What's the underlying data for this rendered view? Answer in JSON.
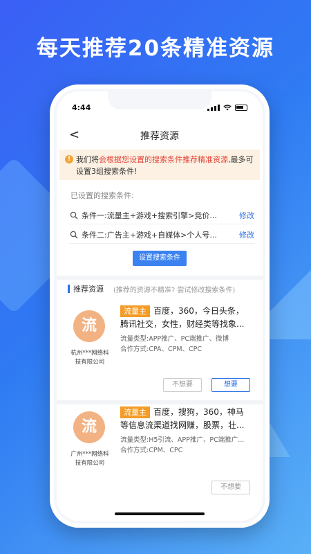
{
  "headline": "每天推荐20条精准资源",
  "status": {
    "time": "4:44"
  },
  "nav": {
    "back": "<",
    "title": "推荐资源"
  },
  "notice": {
    "icon": "!",
    "prefix": "我们将",
    "highlight": "会根据您设置的搜索条件推荐精准资源",
    "suffix": ",最多可设置3组搜索条件!"
  },
  "conditions": {
    "label": "已设置的搜索条件:",
    "items": [
      {
        "text": "条件一:流量主+游戏+搜索引擎>竞价...",
        "edit": "修改"
      },
      {
        "text": "条件二:广告主+游戏+自媒体>个人号...",
        "edit": "修改"
      }
    ],
    "set_button": "设置搜索条件"
  },
  "recommend": {
    "title": "推荐资源",
    "hint": "(推荐的资源不精准? 尝试修改搜索条件)"
  },
  "cards": [
    {
      "avatar": "流",
      "company_line1": "杭州***网络科",
      "company_line2": "技有限公司",
      "tag": "流量主",
      "desc": "百度，360，今日头条，腾讯社交，女性，财经类等找象...",
      "type": "流量类型:APP推广、PC端推广、微博",
      "coop": "合作方式:CPA、CPM、CPC",
      "btn_no": "不想要",
      "btn_yes": "想要"
    },
    {
      "avatar": "流",
      "company_line1": "广州***网络科",
      "company_line2": "技有限公司",
      "tag": "流量主",
      "desc": "百度，搜狗，360，神马等信息流渠道找网赚，股票，壮...",
      "type": "流量类型:H5引流、APP推广、PC端推广...",
      "coop": "合作方式:CPM、CPC",
      "btn_no": "不想要"
    }
  ],
  "colors": {
    "accent": "#2b72e6",
    "tag": "#f39c26",
    "avatar": "#f2b283",
    "highlight": "#e2453b"
  }
}
